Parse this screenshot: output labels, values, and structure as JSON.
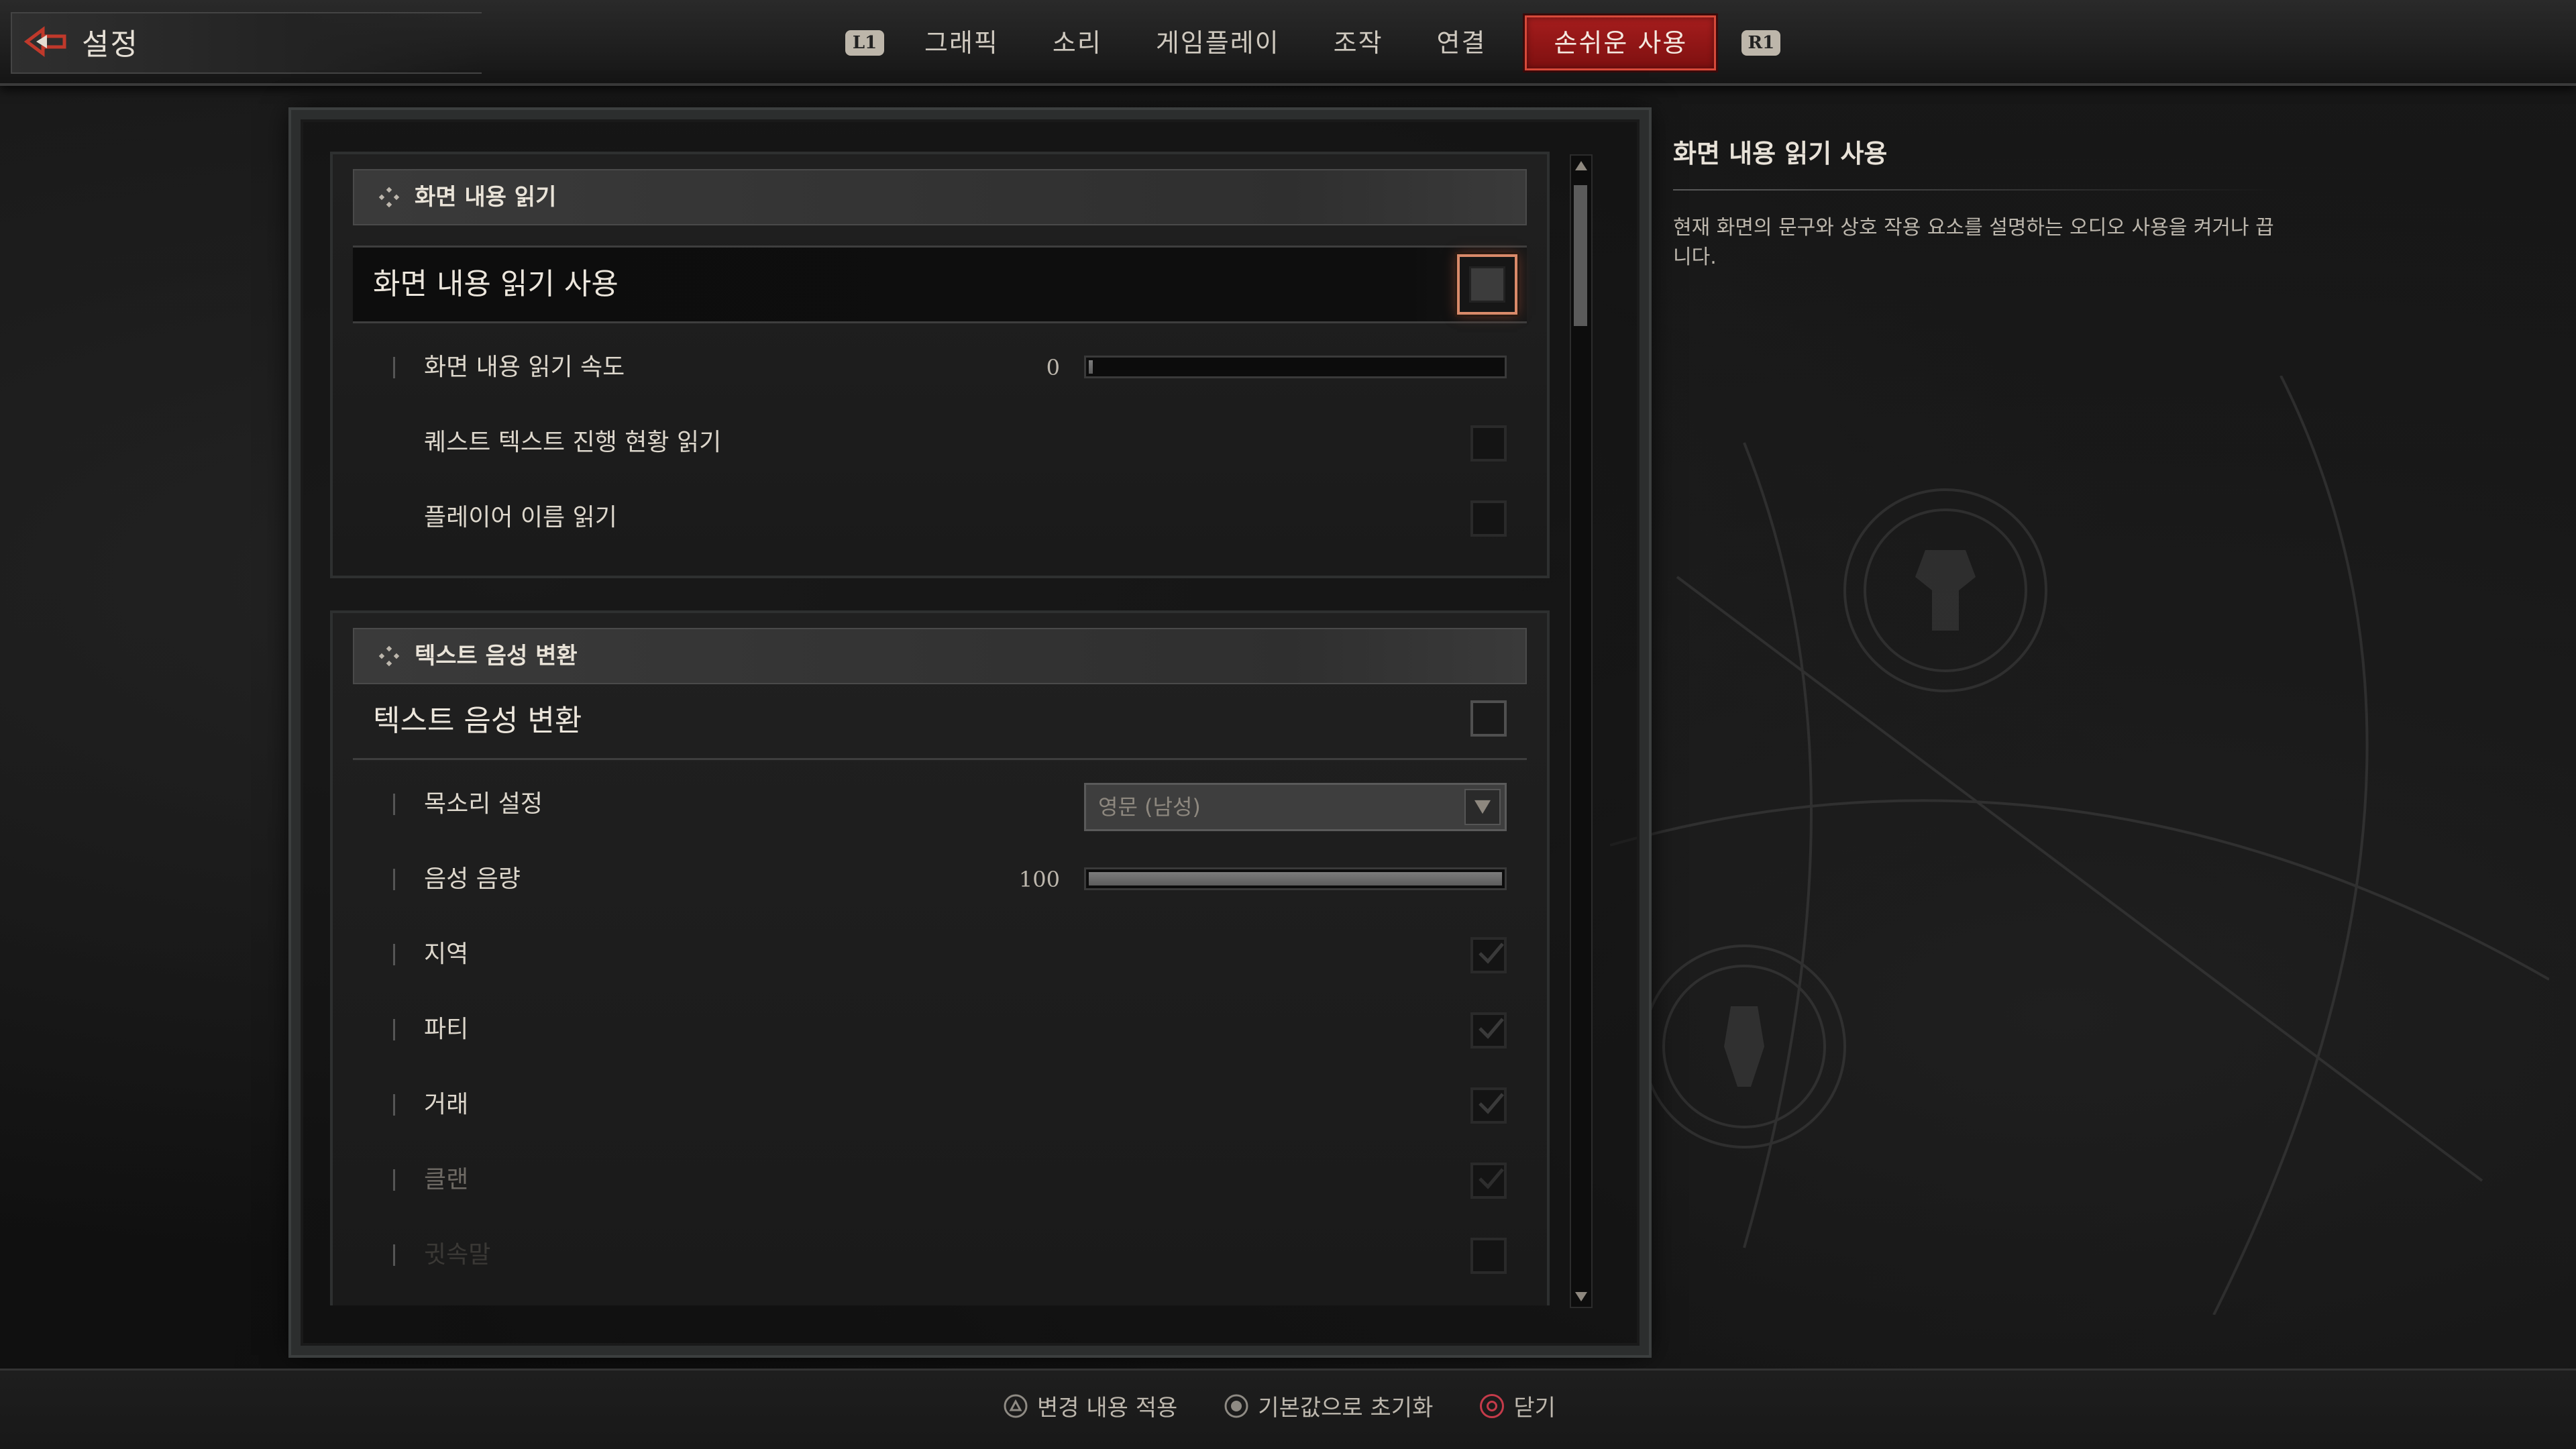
{
  "header": {
    "title": "설정",
    "shoulder_left": "L1",
    "shoulder_right": "R1",
    "tabs": [
      {
        "label": "그래픽"
      },
      {
        "label": "소리"
      },
      {
        "label": "게임플레이"
      },
      {
        "label": "조작"
      },
      {
        "label": "연결"
      },
      {
        "label": "손쉬운 사용"
      }
    ],
    "active_tab": "손쉬운 사용"
  },
  "sections": [
    {
      "header": "화면 내용 읽기",
      "main_label": "화면 내용 읽기 사용",
      "main_checked": false,
      "rows": [
        {
          "label": "화면 내용 읽기 속도",
          "type": "slider",
          "value": "0",
          "fill_percent": 0
        },
        {
          "label": "퀘스트 텍스트 진행 현황 읽기",
          "type": "checkbox",
          "checked": false
        },
        {
          "label": "플레이어 이름 읽기",
          "type": "checkbox",
          "checked": false
        }
      ]
    },
    {
      "header": "텍스트 음성 변환",
      "main_label": "텍스트 음성 변환",
      "main_checked": false,
      "rows": [
        {
          "label": "목소리 설정",
          "type": "dropdown",
          "value": "영문 (남성)"
        },
        {
          "label": "음성 음량",
          "type": "slider",
          "value": "100",
          "fill_percent": 100
        },
        {
          "label": "지역",
          "type": "checkbox",
          "checked": true
        },
        {
          "label": "파티",
          "type": "checkbox",
          "checked": true
        },
        {
          "label": "거래",
          "type": "checkbox",
          "checked": true
        },
        {
          "label": "클랜",
          "type": "checkbox",
          "checked": true
        },
        {
          "label": "귓속말",
          "type": "checkbox",
          "checked": true
        }
      ]
    }
  ],
  "description": {
    "title": "화면 내용 읽기 사용",
    "text": "현재 화면의 문구와 상호 작용 요소를 설명하는 오디오 사용을 켜거나 끕니다."
  },
  "footer": {
    "apply": "변경 내용 적용",
    "reset": "기본값으로 초기화",
    "close": "닫기"
  },
  "colors": {
    "accent_red": "#a51d1d",
    "selection_glow": "#d98a6a",
    "close_button": "#c53b4a"
  }
}
